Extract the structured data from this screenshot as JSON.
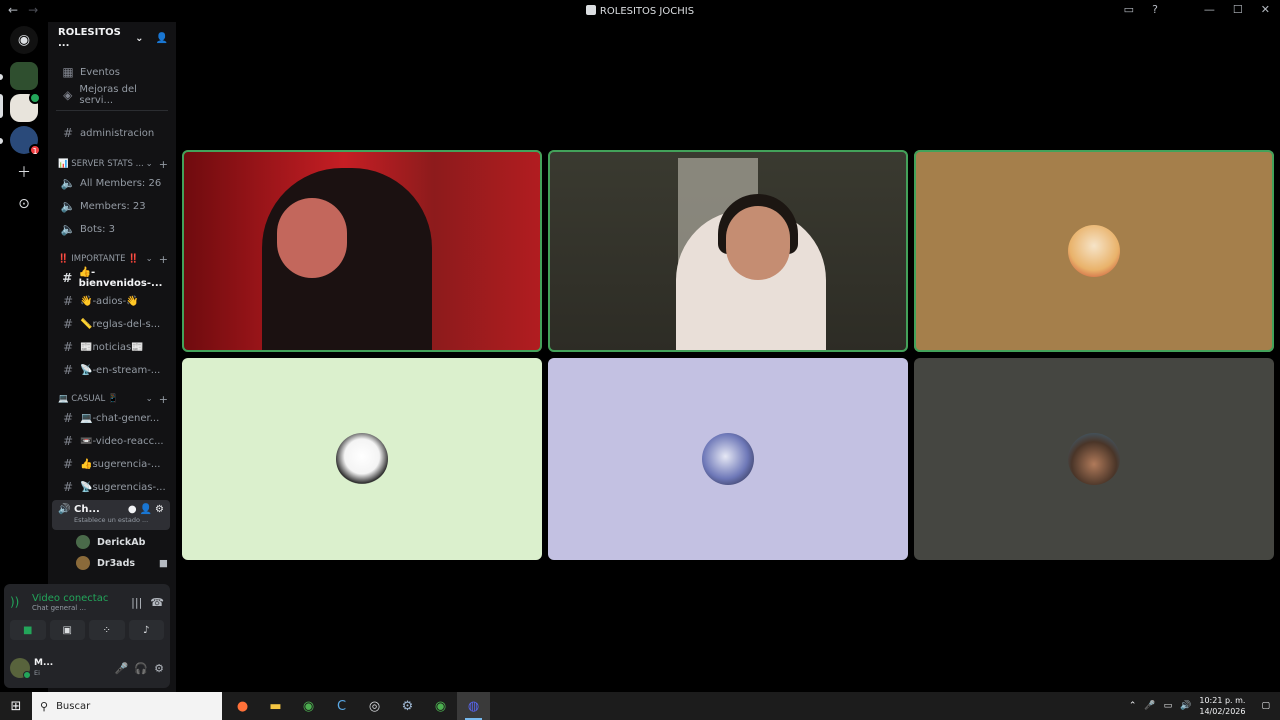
{
  "window": {
    "title": "ROLESITOS JOCHIS"
  },
  "server": {
    "name": "ROLESITOS ..."
  },
  "nav_items": [
    {
      "icon": "calendar-icon",
      "label": "Eventos"
    },
    {
      "icon": "boost-icon",
      "label": "Mejoras del servi..."
    },
    {
      "icon": "hash-icon",
      "label": "administracion"
    }
  ],
  "categories": {
    "stats": {
      "label": "📊 SERVER STATS ..."
    },
    "importante": {
      "label": "‼️ IMPORTANTE ‼️"
    },
    "casual": {
      "label": "💻 CASUAL 📱"
    }
  },
  "stats_channels": [
    {
      "label": "All Members: 26"
    },
    {
      "label": "Members: 23"
    },
    {
      "label": "Bots: 3"
    }
  ],
  "importante_channels": [
    {
      "label": "👍-bienvenidos-...",
      "unread": true
    },
    {
      "label": "👋-adios-👋",
      "unread": false
    },
    {
      "label": "📏reglas-del-s...",
      "unread": false
    },
    {
      "label": "📰noticias📰",
      "unread": false
    },
    {
      "label": "📡-en-stream-...",
      "unread": false
    }
  ],
  "casual_channels": [
    {
      "label": "💻-chat-gener..."
    },
    {
      "label": "📼-video-reacc..."
    },
    {
      "label": "👍sugerencia-..."
    },
    {
      "label": "📡sugerencias-..."
    }
  ],
  "voice_channel": {
    "name": "Ch...",
    "status": "Establece un estado ..."
  },
  "voice_users": [
    {
      "name": "DerickAb"
    },
    {
      "name": "Dr3ads"
    }
  ],
  "voice_panel": {
    "status": "Video conectac",
    "channel": "Chat general ..."
  },
  "user": {
    "name": "M...",
    "sub": "Ei"
  },
  "tiles": [
    {
      "type": "camera",
      "speaking": true
    },
    {
      "type": "camera",
      "speaking": true
    },
    {
      "type": "avatar",
      "speaking": true,
      "bg": "#a57f4b"
    },
    {
      "type": "avatar",
      "speaking": false,
      "bg": "#dbf0cd"
    },
    {
      "type": "avatar",
      "speaking": false,
      "bg": "#c3c1e2"
    },
    {
      "type": "avatar",
      "speaking": false,
      "bg": "#454641"
    }
  ],
  "taskbar": {
    "search_placeholder": "Buscar",
    "time": "10:21 p. m.",
    "date": "14/02/2026"
  },
  "colors": {
    "accent_green": "#23a55a",
    "sidebar_bg": "#121214",
    "panel_bg": "#232428"
  }
}
